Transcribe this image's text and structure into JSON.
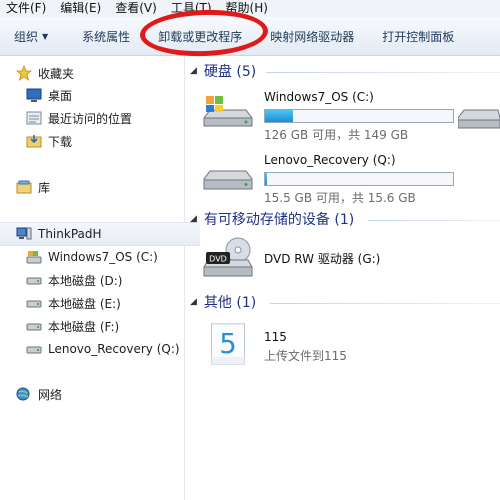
{
  "menu": [
    "文件(F)",
    "编辑(E)",
    "查看(V)",
    "工具(T)",
    "帮助(H)"
  ],
  "toolbar": {
    "organize": "组织",
    "system_props": "系统属性",
    "uninstall": "卸载或更改程序",
    "map_drive": "映射网络驱动器",
    "control_panel": "打开控制面板"
  },
  "nav": {
    "favorites": "收藏夹",
    "desktop": "桌面",
    "recent": "最近访问的位置",
    "downloads": "下载",
    "library": "库",
    "computer": "ThinkPadH",
    "drives": [
      "Windows7_OS (C:)",
      "本地磁盘 (D:)",
      "本地磁盘 (E:)",
      "本地磁盘 (F:)",
      "Lenovo_Recovery (Q:)"
    ],
    "network": "网络"
  },
  "hard_disks": {
    "header": "硬盘 (5)",
    "items": [
      {
        "name": "Windows7_OS (C:)",
        "detail": "126 GB 可用，共 149 GB",
        "used_fraction": 0.15
      },
      {
        "name": "Lenovo_Recovery (Q:)",
        "detail": "15.5 GB 可用，共 15.6 GB",
        "used_fraction": 0.01
      }
    ]
  },
  "removable": {
    "header": "有可移动存储的设备 (1)",
    "dvd_name": "DVD RW 驱动器 (G:)",
    "dvd_badge": "DVD"
  },
  "other": {
    "header": "其他 (1)",
    "name": "115",
    "detail": "上传文件到115",
    "icon_text": "5"
  },
  "colors": {
    "ring": "#e01919",
    "capacity": "#1c8fd3"
  }
}
